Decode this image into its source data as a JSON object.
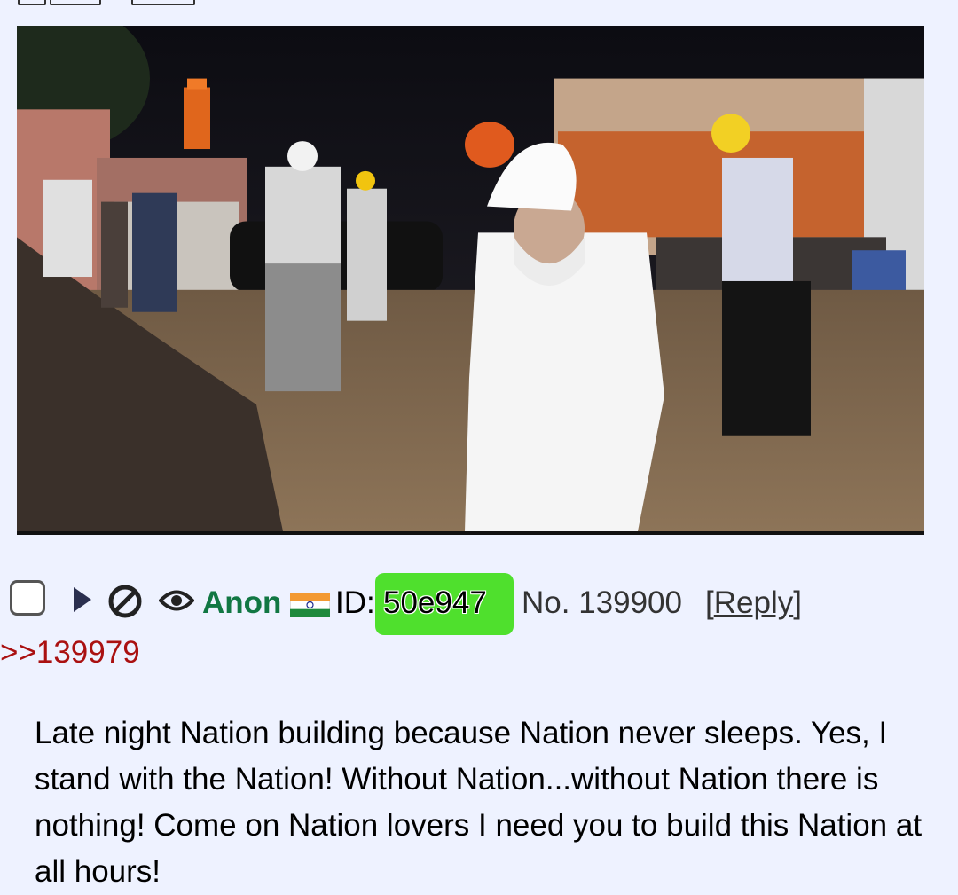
{
  "post": {
    "name": "Anon",
    "flag": "india-flag-icon",
    "id_label": "ID: ",
    "id_value": "50e947",
    "id_color": "#4fe02d",
    "number": "No. 139900",
    "reply_open": "[",
    "reply_label": "Reply",
    "reply_close": "]",
    "backlink": ">>139979",
    "body": "Late night Nation building because Nation never sleeps. Yes, I stand with the Nation! Without Nation...without Nation there is nothing! Come on Nation lovers I need you to build this Nation at all hours!"
  },
  "icons": {
    "expand": "triangle-right-icon",
    "hide": "hide-icon",
    "watch": "eye-icon",
    "select": "checkbox"
  },
  "colors": {
    "background": "#eef2ff",
    "name": "#117743",
    "backlink": "#aa1111"
  }
}
